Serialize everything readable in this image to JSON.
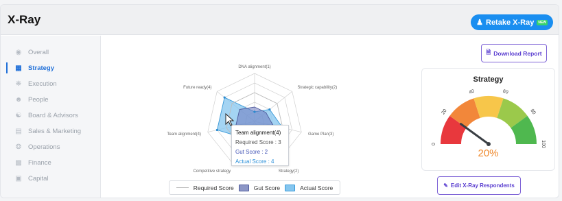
{
  "header": {
    "title": "X-Ray",
    "retake_label": "Retake X-Ray",
    "retake_badge": "NEW"
  },
  "sidebar": {
    "items": [
      {
        "label": "Overall",
        "icon": "circle-icon"
      },
      {
        "label": "Strategy",
        "icon": "chart-icon",
        "active": true
      },
      {
        "label": "Execution",
        "icon": "gears-icon"
      },
      {
        "label": "People",
        "icon": "people-icon"
      },
      {
        "label": "Board & Advisors",
        "icon": "group-icon"
      },
      {
        "label": "Sales & Marketing",
        "icon": "bar-icon"
      },
      {
        "label": "Operations",
        "icon": "cog-icon"
      },
      {
        "label": "Finance",
        "icon": "building-icon"
      },
      {
        "label": "Capital",
        "icon": "money-icon"
      }
    ]
  },
  "buttons": {
    "download": "Download Report",
    "edit_respondents": "Edit X-Ray Respondents"
  },
  "chart_data": [
    {
      "type": "radar",
      "categories": [
        "DNA alignment(1)",
        "Strategic capability(2)",
        "Game Plan(3)",
        "Strategy(2)",
        "Competitive strategy",
        "Team alignment(4)",
        "Future ready(4)"
      ],
      "rlim": [
        0,
        5
      ],
      "series": [
        {
          "name": "Required Score",
          "values": [
            3,
            3,
            3,
            3,
            3,
            3,
            3
          ],
          "color": "#bdbdbd"
        },
        {
          "name": "Gut Score",
          "values": [
            1.5,
            1.5,
            2,
            1.5,
            1.5,
            2,
            2
          ],
          "color": "#8c96c6"
        },
        {
          "name": "Actual Score",
          "values": [
            1,
            2,
            3,
            2,
            2,
            4,
            4
          ],
          "color": "#85c6ef"
        }
      ],
      "tooltip": {
        "title": "Team alignment(4)",
        "required": "Required Score : 3",
        "gut": "Gut Score : 2",
        "actual": "Actual Score : 4"
      },
      "legend_placement": "bottom"
    },
    {
      "type": "gauge",
      "title": "Strategy",
      "value": 20,
      "value_label": "20%",
      "range": [
        0,
        100
      ],
      "ticks": [
        "0",
        "20",
        "40",
        "60",
        "80",
        "100"
      ],
      "bands": [
        "#e8383d",
        "#f2873a",
        "#f7c64a",
        "#9bc94b",
        "#4fb84f"
      ]
    }
  ]
}
